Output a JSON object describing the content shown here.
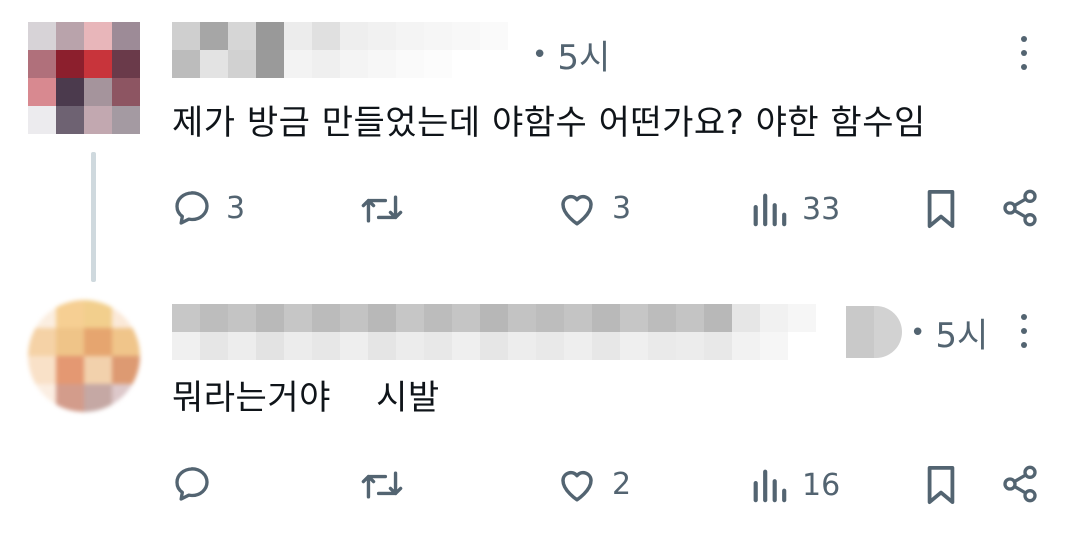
{
  "posts": [
    {
      "time": "5시",
      "text": "제가 방금 만들었는데 야함수 어떤가요? 야한 함수임",
      "reply_count": "3",
      "retweet_count": "",
      "like_count": "3",
      "view_count": "33"
    },
    {
      "time": "5시",
      "text": "뭐라는거야    시발",
      "reply_count": "",
      "retweet_count": "",
      "like_count": "2",
      "view_count": "16"
    }
  ],
  "icons": {
    "reply": "reply-icon",
    "retweet": "retweet-icon",
    "like": "heart-icon",
    "views": "views-icon",
    "bookmark": "bookmark-icon",
    "share": "share-icon",
    "more": "more-vertical-icon"
  },
  "colors": {
    "text": "#0f1419",
    "secondary": "#536471",
    "thread_line": "#cfd9de"
  }
}
